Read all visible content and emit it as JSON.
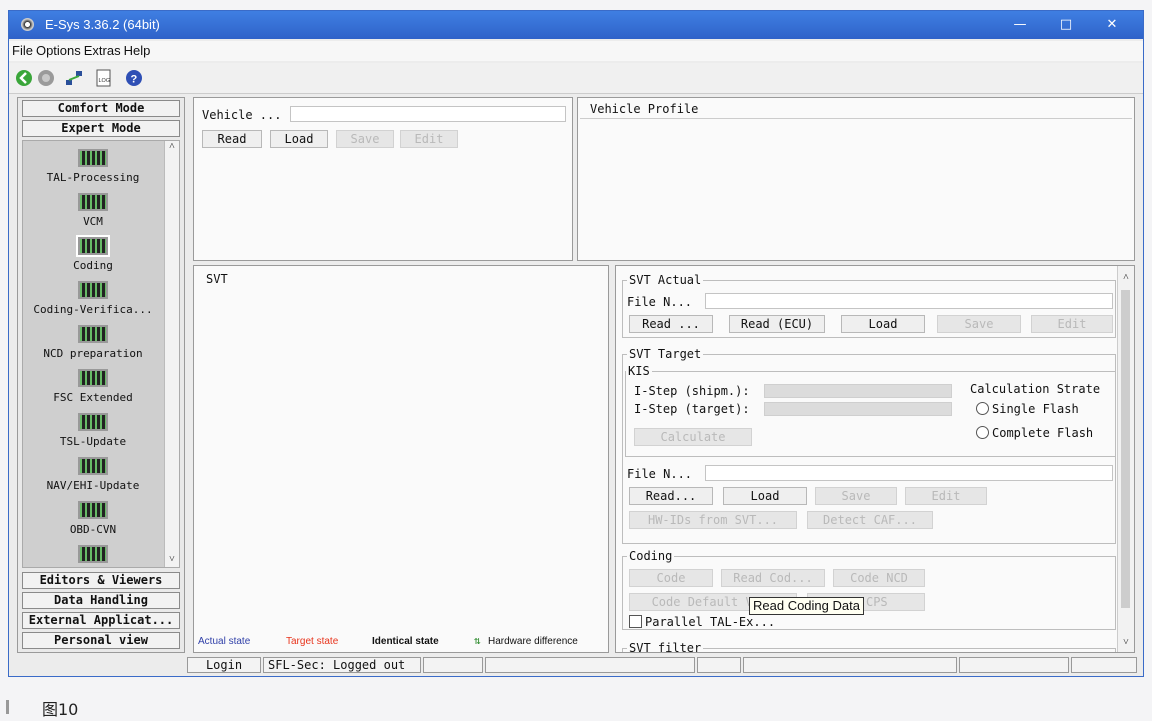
{
  "window": {
    "title": "E-Sys 3.36.2  (64bit)",
    "minimize_icon": "minimize-icon",
    "maximize_icon": "maximize-icon",
    "close_icon": "close-icon"
  },
  "menu": [
    "File",
    "Options",
    "Extras",
    "Help"
  ],
  "toolbar": {
    "icons": [
      "connect-icon",
      "disconnect-icon",
      "network-icon",
      "log-icon",
      "help-icon"
    ],
    "log_label": "LOG"
  },
  "sidebar": {
    "comfort_mode": "Comfort Mode",
    "expert_mode": "Expert Mode",
    "items": [
      {
        "label": "TAL-Processing"
      },
      {
        "label": "VCM"
      },
      {
        "label": "Coding"
      },
      {
        "label": "Coding-Verifica..."
      },
      {
        "label": "NCD preparation"
      },
      {
        "label": "FSC Extended"
      },
      {
        "label": "TSL-Update"
      },
      {
        "label": "NAV/EHI-Update"
      },
      {
        "label": "OBD-CVN"
      }
    ],
    "editors_viewers": "Editors & Viewers",
    "data_handling": "Data Handling",
    "external_applications": "External Applicat...",
    "personal_view": "Personal view"
  },
  "vehicle": {
    "label": "Vehicle ...",
    "value": "",
    "read": "Read",
    "load": "Load",
    "save": "Save",
    "edit": "Edit"
  },
  "vehicle_profile": {
    "title": "Vehicle Profile"
  },
  "svt": {
    "title": "SVT",
    "legend": {
      "actual": "Actual state",
      "target": "Target state",
      "identical": "Identical state",
      "hardware": "Hardware difference"
    },
    "legend_colors": {
      "actual": "#2f3fa8",
      "target": "#e8341c",
      "identical": "#111111",
      "hardware": "#2a8a2a"
    }
  },
  "svt_actual": {
    "title": "SVT Actual",
    "file_label": "File N...",
    "file_value": "",
    "read": "Read ...",
    "read_ecu": "Read (ECU)",
    "load": "Load",
    "save": "Save",
    "edit": "Edit"
  },
  "svt_target": {
    "title": "SVT Target",
    "kis": {
      "title": "KIS",
      "istep_shipm": "I-Step (shipm.):",
      "istep_target": "I-Step (target):",
      "calculate": "Calculate",
      "calc_strategy": "Calculation Strate",
      "single_flash": "Single Flash",
      "complete_flash": "Complete Flash"
    },
    "file_label": "File N...",
    "file_value": "",
    "read": "Read...",
    "load": "Load",
    "save": "Save",
    "edit": "Edit",
    "hwids": "HW-IDs from SVT...",
    "detect_caf": "Detect CAF..."
  },
  "coding": {
    "title": "Coding",
    "code": "Code",
    "read_cod": "Read Cod...",
    "code_ncd": "Code NCD",
    "code_default": "Code Default V...",
    "cps": "...CPS",
    "parallel": "Parallel TAL-Ex...",
    "tooltip": "Read Coding Data"
  },
  "svt_filter": {
    "title": "SVT filter"
  },
  "status": {
    "login": "Login",
    "sec": "SFL-Sec: Logged out"
  },
  "caption": "图10"
}
